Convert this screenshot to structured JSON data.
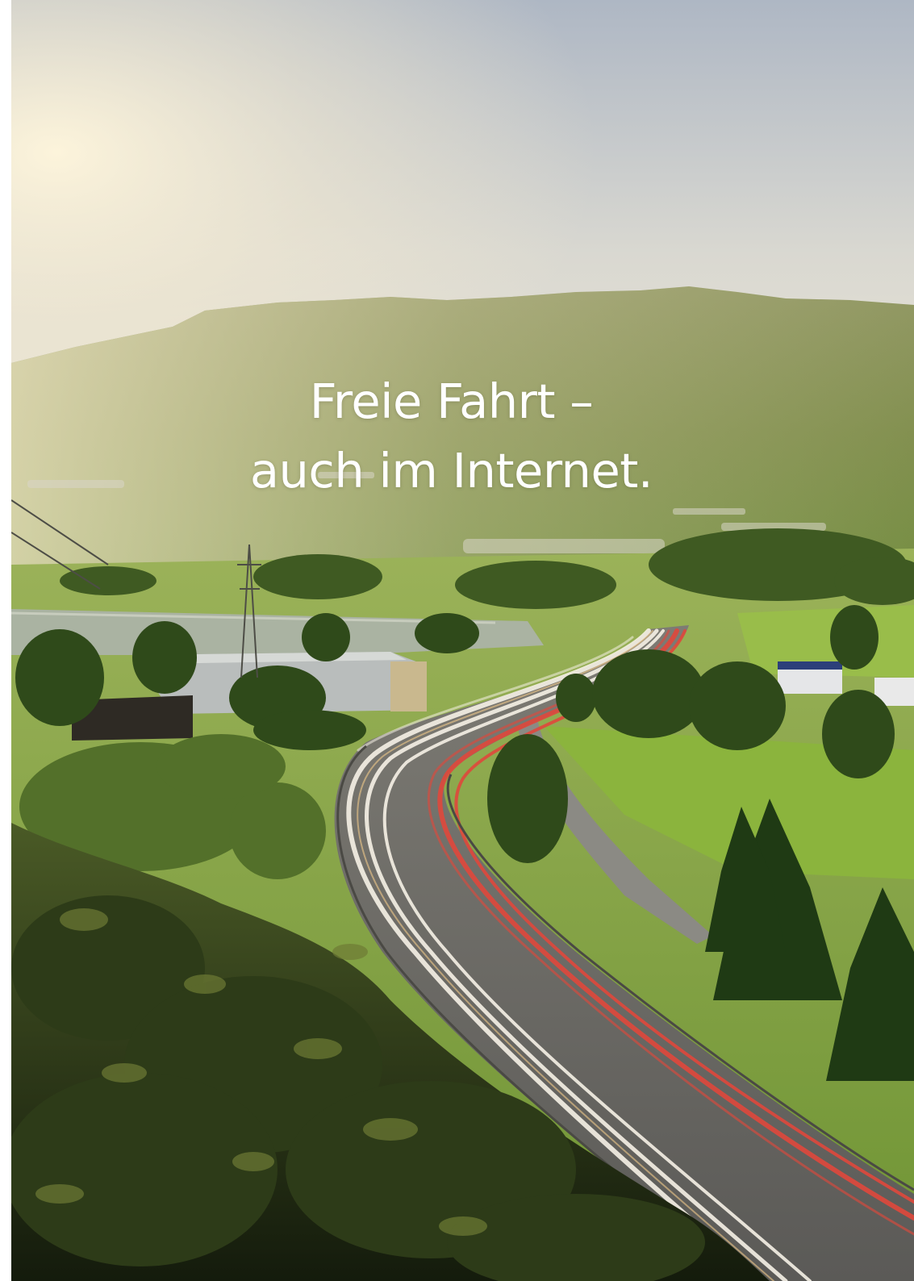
{
  "headline": {
    "line1": "Freie Fahrt –",
    "line2": "auch im Internet."
  },
  "colors": {
    "sky_top": "#aeb7c4",
    "sky_glow": "#f1ead6",
    "mountain": "#7f8a4e",
    "meadow": "#8fae45",
    "foliage_dark": "#1f2a14",
    "light_trail_white": "#f4efe6",
    "light_trail_red": "#e0483c"
  }
}
